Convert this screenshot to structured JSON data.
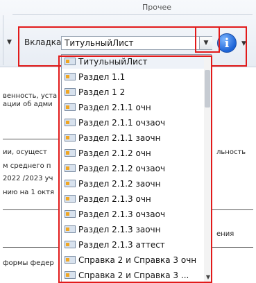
{
  "ribbon": {
    "group_label": "Прочее",
    "tab_label": "Вкладка",
    "combo_value": "ТитульныйЛист",
    "combo_button_icon": "chevron-down-icon",
    "info_icon": "info-icon",
    "info_glyph": "i"
  },
  "document": {
    "lines": [
      "венность, уста",
      "ации об адми",
      "ии, осущест",
      "м среднего п",
      "2022 /2023 уч",
      "нию на 1 октя",
      "формы федер"
    ],
    "right_fragments": [
      "льность",
      "ения"
    ]
  },
  "dropdown": {
    "items": [
      "ТитульныйЛист",
      "Раздел 1.1",
      "Раздел 1 2",
      "Раздел 2.1.1 очн",
      "Раздел 2.1.1 очзаоч",
      "Раздел 2.1.1 заочн",
      "Раздел 2.1.2 очн",
      "Раздел 2.1.2 очзаоч",
      "Раздел 2.1.2 заочн",
      "Раздел 2.1.3 очн",
      "Раздел 2.1.3 очзаоч",
      "Раздел 2.1.3 заочн",
      "Раздел 2.1.3 аттест",
      "Справка 2 и Справка 3 очн",
      "Справка 2 и Справка 3 ..."
    ],
    "item_icon": "sheet-icon"
  },
  "colors": {
    "highlight": "#e21a1a",
    "info_blue": "#1c63d6"
  }
}
